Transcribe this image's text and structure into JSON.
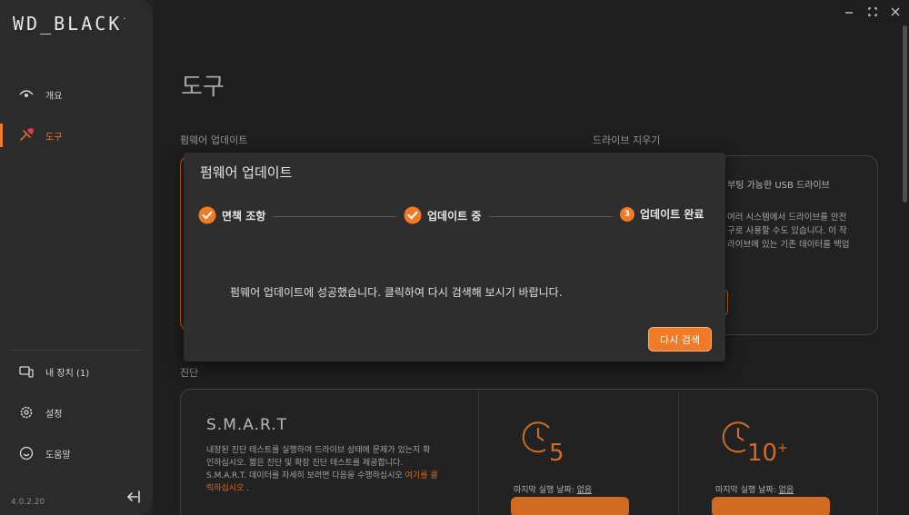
{
  "app": {
    "logo": "WD_BLACK",
    "logo_mark": ".",
    "version": "4.0.2.20"
  },
  "sidebar": {
    "items": [
      {
        "label": "개요",
        "icon": "eye-icon"
      },
      {
        "label": "도구",
        "icon": "tools-icon",
        "active": true
      },
      {
        "label": "내 장치 (1)",
        "icon": "devices-icon"
      },
      {
        "label": "설정",
        "icon": "gear-icon"
      },
      {
        "label": "도움말",
        "icon": "help-icon"
      }
    ]
  },
  "main": {
    "title": "도구",
    "firmware_section": "펌웨어 업데이트",
    "erase_section": "드라이브 지우기",
    "erase_lines": [
      "부팅 가능한 USB 드라이브",
      "여러 시스템에서 드라이브를 안전",
      "구로 사용할 수도 있습니다. 이 작",
      "라이브에 있는 기존 데이터를 백업"
    ],
    "diag_section": "진단",
    "smart": {
      "title": "S.M.A.R.T",
      "desc": [
        "내장된 진단 테스트를 실행하여 드라이브 상태에 문제가 있는지 확",
        "인하십시오. 짧은 진단 및 확장 진단 테스트를 제공합니다.",
        "S.M.A.R.T. 데이터를 자세히 보려면 다음을 수행하십시오"
      ],
      "link_a": "여기를 클",
      "link_b": "릭하십시오",
      "after_link": "."
    },
    "tests": [
      {
        "minutes": "5",
        "last_run_label": "마지막 실행 날짜:",
        "last_run_value": "없음"
      },
      {
        "minutes": "10",
        "suffix": "+",
        "last_run_label": "마지막 실행 날짜:",
        "last_run_value": "없음"
      }
    ]
  },
  "modal": {
    "title": "펌웨어 업데이트",
    "steps": [
      {
        "label": "면책 조항",
        "state": "done"
      },
      {
        "label": "업데이트 중",
        "state": "done"
      },
      {
        "label": "업데이트 완료",
        "state": "current",
        "number": "3"
      }
    ],
    "message": "펌웨어 업데이트에 성공했습니다. 클릭하여 다시 검색해 보시기 바랍니다.",
    "button": "다시 검색"
  },
  "colors": {
    "accent": "#f07a26",
    "background": "#232323",
    "sidebar": "#2b2b2b"
  }
}
